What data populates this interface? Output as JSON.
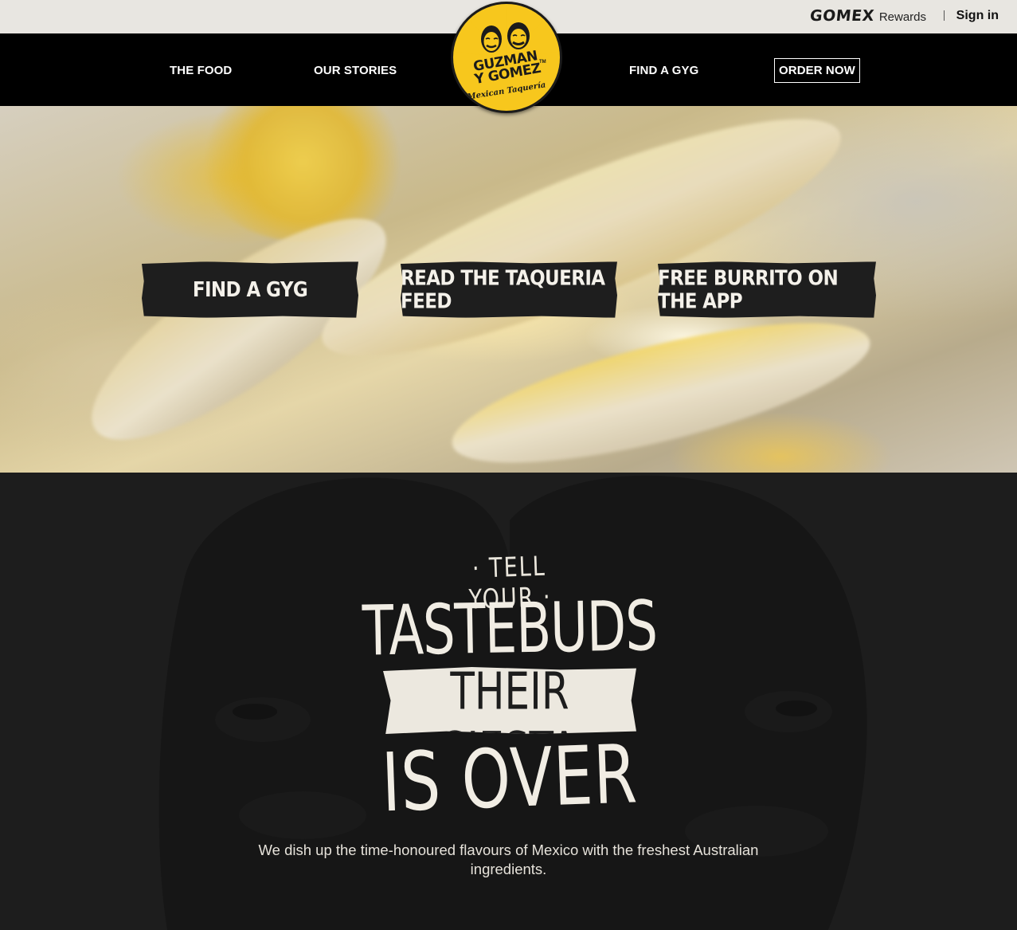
{
  "topbar": {
    "gomex_logo": "GOMEX",
    "gomex_rewards": "Rewards",
    "signin_label": "Sign in"
  },
  "nav": {
    "items": [
      {
        "label": "THE FOOD"
      },
      {
        "label": "OUR STORIES"
      },
      {
        "label": "FIND A GYG"
      },
      {
        "label": "ORDER NOW"
      }
    ]
  },
  "logo": {
    "line1": "GUZMAN",
    "line2": "Y GOMEZ",
    "tm": "TM",
    "subtitle": "Mexican Taquería",
    "background_color": "#f7c71d"
  },
  "hero": {
    "buttons": [
      {
        "label": "FIND A GYG"
      },
      {
        "label": "READ THE TAQUERIA FEED"
      },
      {
        "label": "FREE BURRITO ON THE APP"
      }
    ]
  },
  "intro": {
    "tagline_line1": "· TELL YOUR ·",
    "tagline_line2": "TASTEBUDS",
    "tagline_line3": "THEIR SIESTA",
    "tagline_line4": "IS OVER",
    "description": "We dish up the time-honoured flavours of Mexico with the freshest Australian ingredients."
  },
  "colors": {
    "nav_bg": "#000000",
    "topbar_bg": "#e8e6e1",
    "brand_yellow": "#f7c71d",
    "dark_section_bg": "#1d1d1d"
  }
}
